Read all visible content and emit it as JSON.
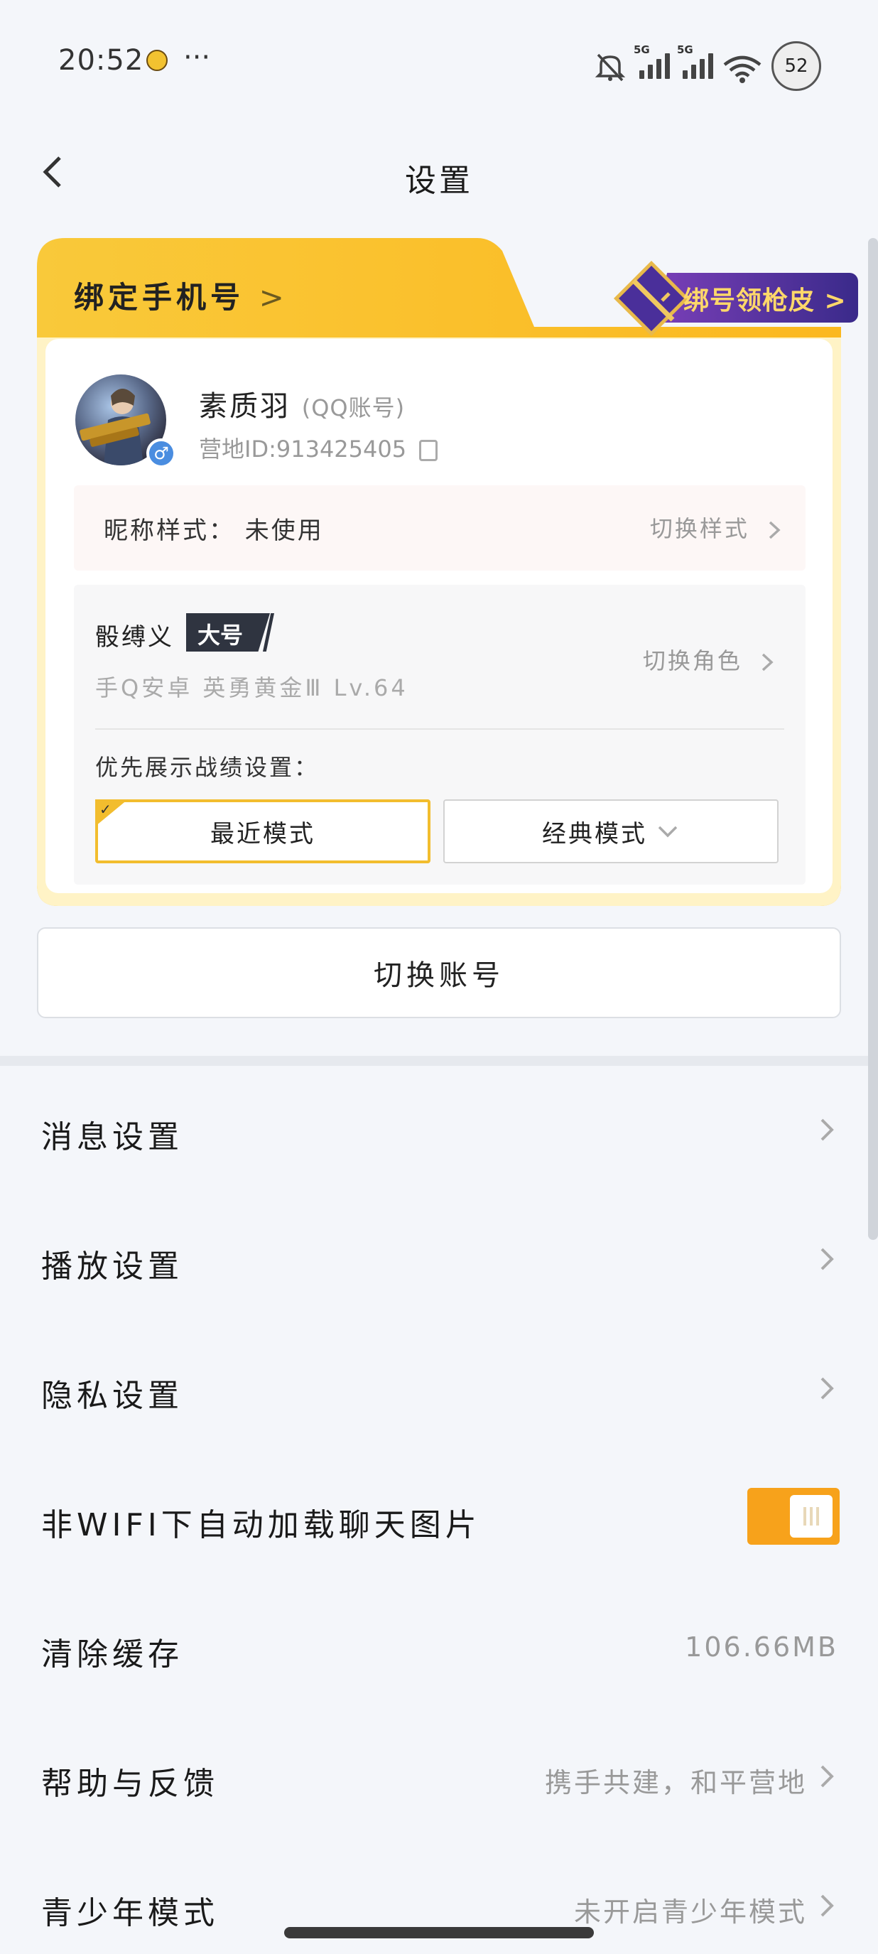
{
  "status_bar": {
    "time": "20:52",
    "more": "···",
    "signal1_tag": "5G",
    "signal2_tag": "5G",
    "battery": "52",
    "icons": [
      "mute-bell-icon",
      "signal-icon",
      "signal-icon",
      "wifi-icon",
      "battery-icon"
    ]
  },
  "header": {
    "title": "设置"
  },
  "bind_card": {
    "title": "绑定手机号",
    "title_chevron": ">",
    "promo": "绑号领枪皮 >",
    "accent_color": "#f9c22e"
  },
  "profile": {
    "name": "素质羽",
    "account_type": "(QQ账号)",
    "camp_id": "营地ID:913425405",
    "gender": "♂"
  },
  "nickname": {
    "label": "昵称样式： 未使用",
    "action": "切换样式"
  },
  "role": {
    "name": "骰缚义",
    "badge": "大号",
    "detail": "手Q安卓  英勇黄金Ⅲ  Lv.64",
    "action": "切换角色",
    "pref_label": "优先展示战绩设置：",
    "mode_recent": "最近模式",
    "mode_classic": "经典模式"
  },
  "switch_account": "切换账号",
  "settings": [
    {
      "label": "消息设置"
    },
    {
      "label": "播放设置"
    },
    {
      "label": "隐私设置"
    },
    {
      "label": "非WIFI下自动加载聊天图片",
      "toggle": true
    },
    {
      "label": "清除缓存",
      "value": "106.66MB"
    },
    {
      "label": "帮助与反馈",
      "value": "携手共建，和平营地"
    },
    {
      "label": "青少年模式",
      "value": "未开启青少年模式"
    }
  ],
  "colors": {
    "toggle_on": "#f7a21b",
    "selected_border": "#f2bd2e"
  }
}
